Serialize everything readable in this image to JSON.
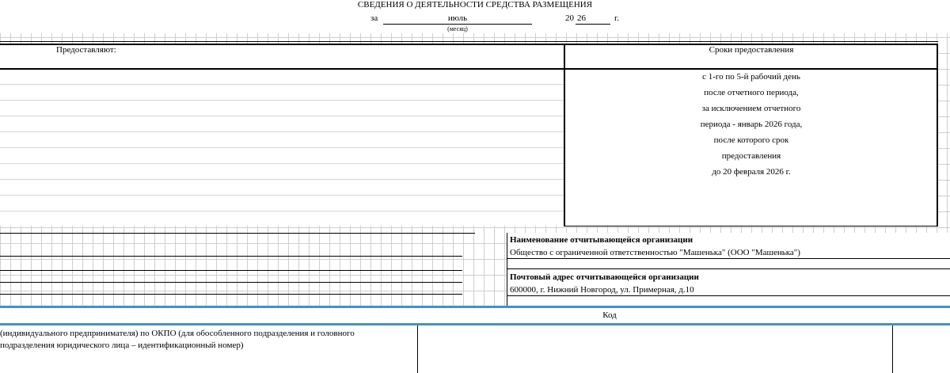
{
  "header": {
    "title": "СВЕДЕНИЯ О ДЕЯТЕЛЬНОСТИ СРЕДСТВА РАЗМЕЩЕНИЯ",
    "prefix": "за",
    "month": "июль",
    "month_caption": "(месяц)",
    "year_prefix": "20",
    "year_suffix": "26",
    "year_unit": "г."
  },
  "submission_table": {
    "left_header": "Предоставляют:",
    "right_header": "Сроки предоставления",
    "deadline_lines": [
      "с 1-го по 5-й рабочий день",
      "после отчетного периода,",
      "за исключением отчетного",
      "периода - январь 2026 года,",
      "после которого срок",
      "предоставления",
      "до 20 февраля 2026 г."
    ]
  },
  "organization": {
    "name_label": "Наименование отчитывающейся организации",
    "name_value": "Общество с ограниченной ответственностью \"Машенька\" (ООО \"Машенька\")",
    "address_label": "Почтовый адрес отчитывающейся организации",
    "address_value": "600000, г. Нижний Новгород, ул. Примерная, д.10"
  },
  "code_section": {
    "header": "Код",
    "okpo_text_line1": "(индивидуального  предпринимателя) по ОКПО (для  обособленного подразделения и головного",
    "okpo_text_line2": "подразделения юридического лица – идентификационный номер)"
  },
  "colors": {
    "grid": "#cfcfcf",
    "accent_blue": "#4a90c4",
    "border": "#000000"
  }
}
